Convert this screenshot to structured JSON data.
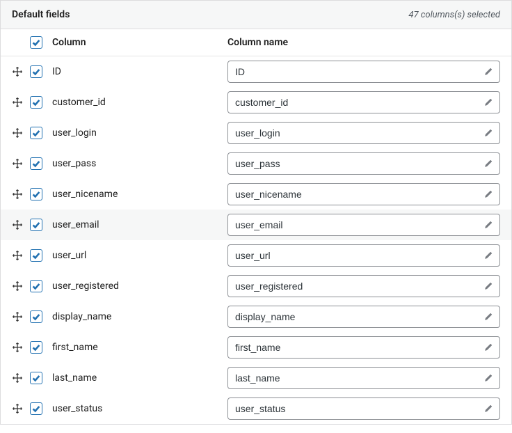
{
  "panel": {
    "title": "Default fields",
    "status": "47 columns(s) selected"
  },
  "headers": {
    "column": "Column",
    "column_name": "Column name"
  },
  "master_check": true,
  "rows": [
    {
      "column": "ID",
      "name": "ID",
      "checked": true,
      "hover": false
    },
    {
      "column": "customer_id",
      "name": "customer_id",
      "checked": true,
      "hover": false
    },
    {
      "column": "user_login",
      "name": "user_login",
      "checked": true,
      "hover": false
    },
    {
      "column": "user_pass",
      "name": "user_pass",
      "checked": true,
      "hover": false
    },
    {
      "column": "user_nicename",
      "name": "user_nicename",
      "checked": true,
      "hover": false
    },
    {
      "column": "user_email",
      "name": "user_email",
      "checked": true,
      "hover": true
    },
    {
      "column": "user_url",
      "name": "user_url",
      "checked": true,
      "hover": false
    },
    {
      "column": "user_registered",
      "name": "user_registered",
      "checked": true,
      "hover": false
    },
    {
      "column": "display_name",
      "name": "display_name",
      "checked": true,
      "hover": false
    },
    {
      "column": "first_name",
      "name": "first_name",
      "checked": true,
      "hover": false
    },
    {
      "column": "last_name",
      "name": "last_name",
      "checked": true,
      "hover": false
    },
    {
      "column": "user_status",
      "name": "user_status",
      "checked": true,
      "hover": false
    }
  ]
}
